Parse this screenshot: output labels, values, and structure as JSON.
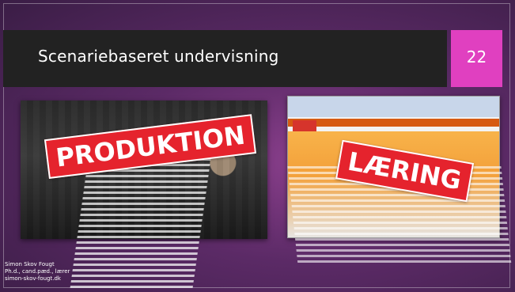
{
  "slide": {
    "title": "Scenariebaseret undervisning",
    "page_number": "22",
    "accent_color": "#e040c0"
  },
  "left_image": {
    "label": "PRODUKTION",
    "label_color": "#e5232d",
    "icon": "photo-icon"
  },
  "right_image": {
    "label": "LÆRING",
    "label_color": "#e5232d",
    "icon": "screenshot-icon"
  },
  "footer": {
    "line1": "Simon Skov Fougt",
    "line2": "Ph.d., cand.pæd., lærer",
    "line3": "simon-skov-fougt.dk"
  }
}
